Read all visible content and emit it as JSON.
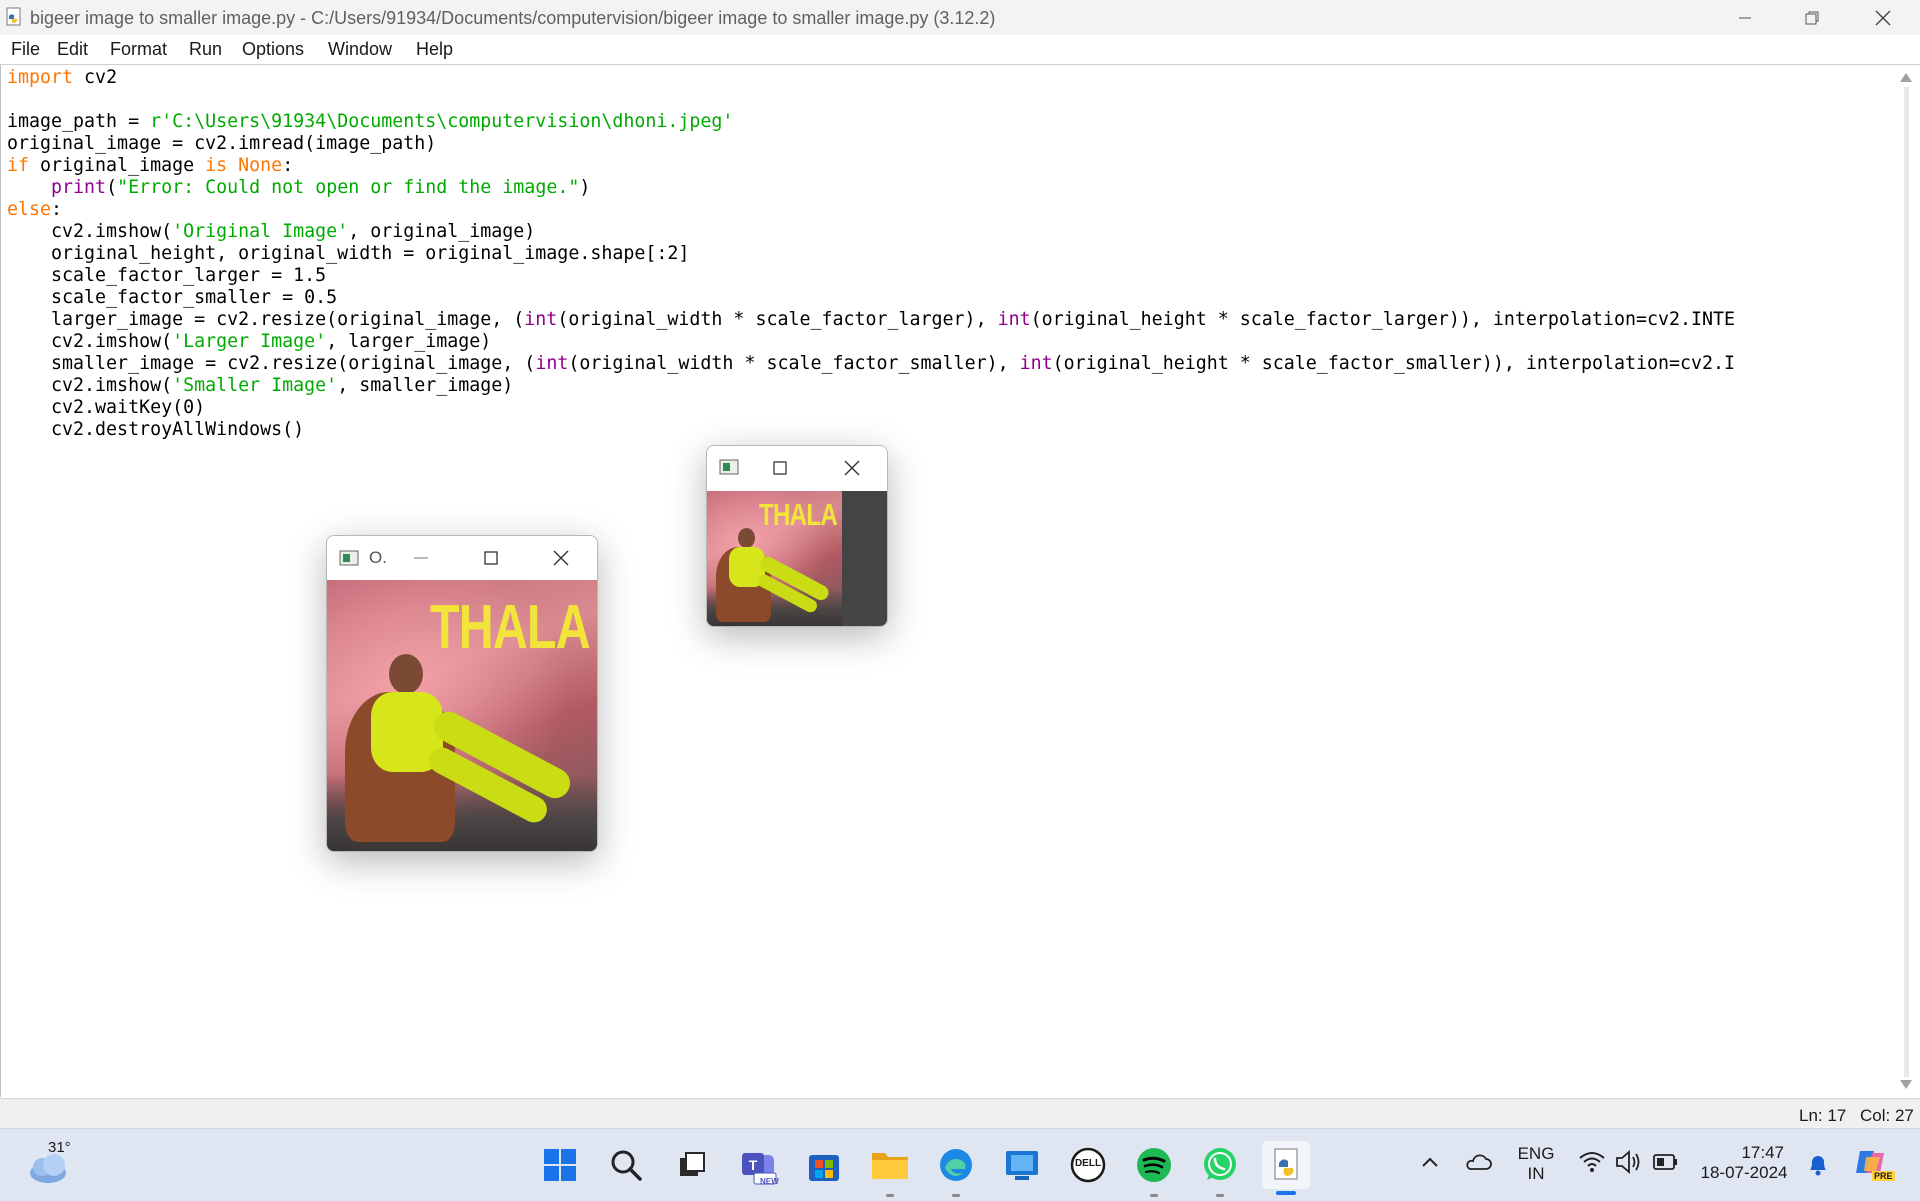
{
  "window": {
    "title": "bigeer image to smaller image.py - C:/Users/91934/Documents/computervision/bigeer image to smaller image.py (3.12.2)"
  },
  "menu": [
    "File",
    "Edit",
    "Format",
    "Run",
    "Options",
    "Window",
    "Help"
  ],
  "code_lines": [
    "import cv2",
    "",
    "image_path = r'C:\\Users\\91934\\Documents\\computervision\\dhoni.jpeg'",
    "original_image = cv2.imread(image_path)",
    "if original_image is None:",
    "    print(\"Error: Could not open or find the image.\")",
    "else:",
    "    cv2.imshow('Original Image', original_image)",
    "    original_height, original_width = original_image.shape[:2]",
    "    scale_factor_larger = 1.5",
    "    scale_factor_smaller = 0.5",
    "    larger_image = cv2.resize(original_image, (int(original_width * scale_factor_larger), int(original_height * scale_factor_larger)), interpolation=cv2.INTE",
    "    cv2.imshow('Larger Image', larger_image)",
    "    smaller_image = cv2.resize(original_image, (int(original_width * scale_factor_smaller), int(original_height * scale_factor_smaller)), interpolation=cv2.I",
    "    cv2.imshow('Smaller Image', smaller_image)",
    "    cv2.waitKey(0)",
    "    cv2.destroyAllWindows()"
  ],
  "syntax_colors": {
    "keyword": "#ff7700",
    "builtin": "#900090",
    "string": "#00aa00",
    "default": "#000000"
  },
  "status": {
    "line": "Ln: 17",
    "col": "Col: 27"
  },
  "image_windows": {
    "original": {
      "title": "O.",
      "poster_text": "THALA"
    },
    "smaller": {
      "poster_text": "THALA"
    }
  },
  "taskbar": {
    "weather_temp": "31°",
    "apps": [
      "start-icon",
      "search-icon",
      "task-view-icon",
      "teams-icon",
      "store-icon",
      "file-explorer-icon",
      "edge-icon",
      "blue-app-icon",
      "dell-icon",
      "spotify-icon",
      "whatsapp-icon",
      "python-idle-icon"
    ],
    "teams_badge": "NEW",
    "dell_label": "DELL",
    "lang_top": "ENG",
    "lang_bottom": "IN",
    "time": "17:47",
    "date": "18-07-2024",
    "copilot_badge": "PRE"
  }
}
